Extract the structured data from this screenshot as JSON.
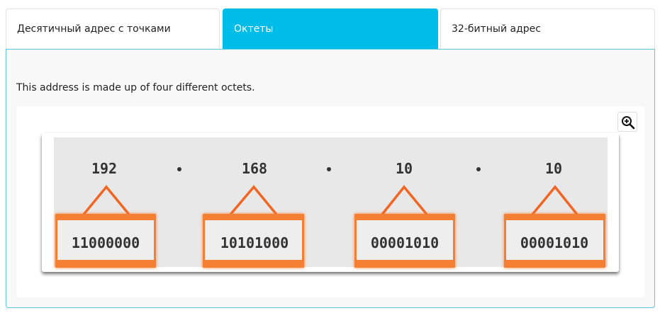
{
  "tabs": [
    {
      "label": "Десятичный адрес с точками",
      "active": false
    },
    {
      "label": "Октеты",
      "active": true
    },
    {
      "label": "32-битный адрес",
      "active": false
    }
  ],
  "panel": {
    "description": "This address is made up of four different octets."
  },
  "figure": {
    "zoom_icon": "zoom-in-icon",
    "octets": [
      {
        "decimal": "192",
        "binary": "11000000"
      },
      {
        "decimal": "168",
        "binary": "10101000"
      },
      {
        "decimal": "10",
        "binary": "00001010"
      },
      {
        "decimal": "10",
        "binary": "00001010"
      }
    ],
    "colors": {
      "accent_orange": "#f26522",
      "tab_active": "#00bce8",
      "diagram_bg": "#e9e8e9"
    }
  }
}
